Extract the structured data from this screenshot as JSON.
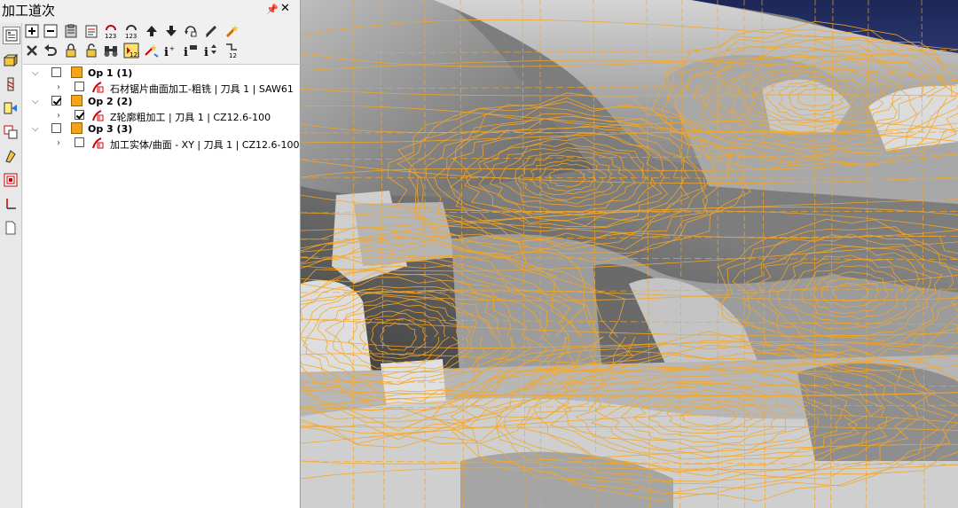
{
  "panel": {
    "title": "加工道次",
    "pin_symbol": "⬇",
    "close_symbol": "✕"
  },
  "toolbar": {
    "row1_icons": [
      "expand-all-icon",
      "collapse-all-icon",
      "clipboard-icon",
      "notes-icon",
      "renumber-icon",
      "renumber-alt-icon",
      "move-up-icon",
      "move-down-icon",
      "refresh-icon",
      "edit-icon",
      "magic-icon"
    ],
    "row2_icons": [
      "delete-icon",
      "undo-icon",
      "lock-icon",
      "unlock-icon",
      "binoculars-icon",
      "number-list-icon",
      "transform-icon",
      "info-icon",
      "info-a-icon",
      "info-b-icon",
      "step-icon"
    ],
    "row1_text_123": "123",
    "row2_text_12": "12"
  },
  "sidebar": {
    "icons": [
      "operations-icon",
      "solids-icon",
      "tools-icon",
      "toolpath-icon",
      "planes-icon",
      "levels-icon",
      "art-icon",
      "coordinates-icon",
      "document-icon"
    ]
  },
  "tree": {
    "ops": [
      {
        "label": "Op 1 (1)",
        "checked": false,
        "child": {
          "label": "石材锯片曲面加工-粗铣 | 刀具 1 | SAW61",
          "checked": false
        }
      },
      {
        "label": "Op 2 (2)",
        "checked": true,
        "child": {
          "label": "Z轮廓粗加工 | 刀具 1 | CZ12.6-100",
          "checked": true
        }
      },
      {
        "label": "Op 3 (3)",
        "checked": false,
        "child": {
          "label": "加工实体/曲面 - XY | 刀具 1 | CZ12.6-100",
          "checked": false
        }
      }
    ]
  },
  "colors": {
    "op_square": "#f5a31a",
    "toolpath": "#f5a623",
    "model": "#8c8c8c",
    "background_top": "#1f2a55"
  }
}
